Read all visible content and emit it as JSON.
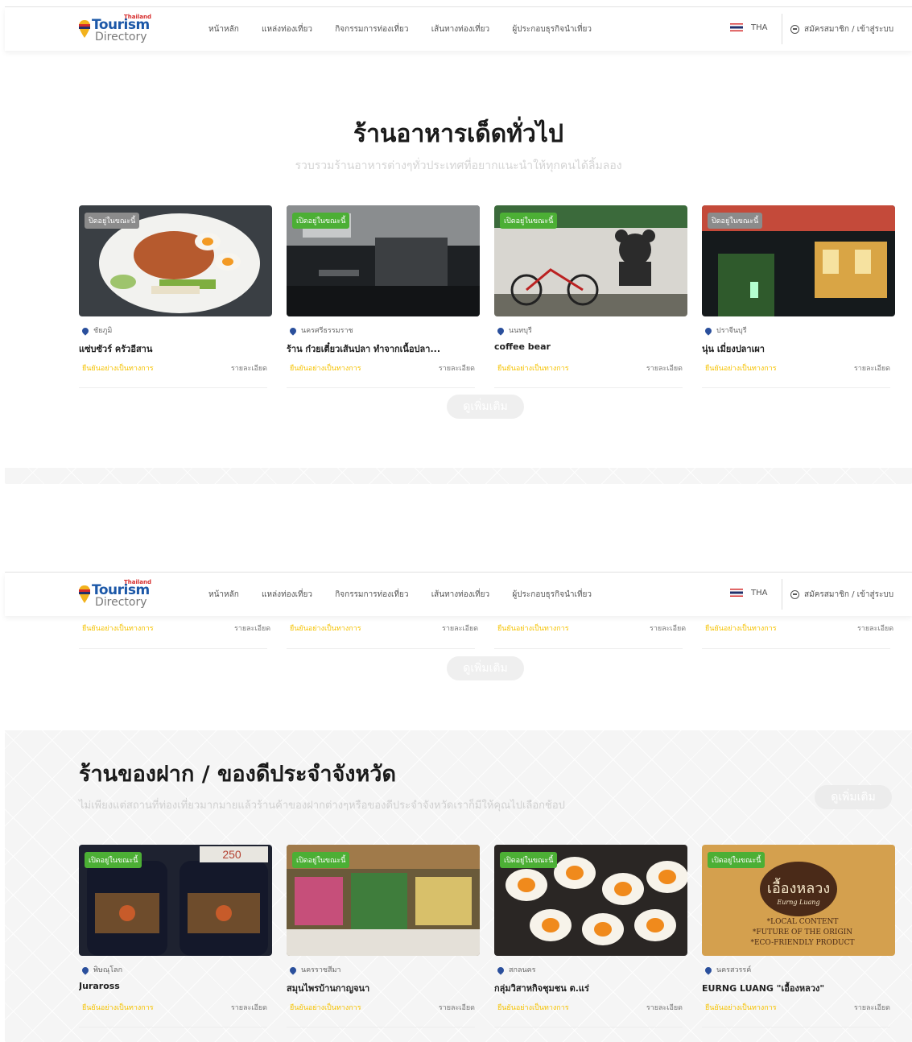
{
  "nav": {
    "logo_small": "Thailand",
    "logo_main": "Tourism",
    "logo_sub": "Directory",
    "menu": [
      "หน้าหลัก",
      "แหล่งท่องเที่ยว",
      "กิจกรรมการท่องเที่ยว",
      "เส้นทางท่องเที่ยว",
      "ผู้ประกอบธุรกิจนำเที่ยว"
    ],
    "lang": "THA",
    "login": "สมัครสมาชิก / เข้าสู่ระบบ"
  },
  "restaurants": {
    "title": "ร้านอาหารเด็ดทั่วไป",
    "subtitle": "รวบรวมร้านอาหารต่างๆทั่วประเทศที่อยากแนะนำให้ทุกคนได้ลิ้มลอง",
    "more": "ดูเพิ่มเติม",
    "cards": [
      {
        "badge": "ปิดอยู่ในขณะนี้",
        "status": "closed",
        "province": "ชัยภูมิ",
        "name": "แซ่บซัวร์ ครัวอีสาน",
        "verified": "ยืนยันอย่างเป็นทางการ",
        "detail": "รายละเอียด"
      },
      {
        "badge": "เปิดอยู่ในขณะนี้",
        "status": "open",
        "province": "นครศรีธรรมราช",
        "name": "ร้าน ก๋วยเตี๋ยวเส้นปลา ทำจากเนื้อปลา...",
        "verified": "ยืนยันอย่างเป็นทางการ",
        "detail": "รายละเอียด"
      },
      {
        "badge": "เปิดอยู่ในขณะนี้",
        "status": "open",
        "province": "นนทบุรี",
        "name": "coffee bear",
        "verified": "ยืนยันอย่างเป็นทางการ",
        "detail": "รายละเอียด"
      },
      {
        "badge": "ปิดอยู่ในขณะนี้",
        "status": "closed",
        "province": "ปราจีนบุรี",
        "name": "นุ่น เมี่ยงปลาเผา",
        "verified": "ยืนยันอย่างเป็นทางการ",
        "detail": "รายละเอียด"
      }
    ]
  },
  "scrolled": {
    "verified": "ยืนยันอย่างเป็นทางการ",
    "detail": "รายละเอียด",
    "more": "ดูเพิ่มเติม"
  },
  "souvenirs": {
    "title": "ร้านของฝาก / ของดีประจำจังหวัด",
    "subtitle": "ไม่เพียงแต่สถานที่ท่องเที่ยวมากมายแล้วร้านค้าของฝากต่างๆหรือของดีประจำจังหวัดเราก็มีให้คุณไปเลือกช้อป",
    "more": "ดูเพิ่มเติม",
    "cards": [
      {
        "badge": "เปิดอยู่ในขณะนี้",
        "status": "open",
        "province": "พิษณุโลก",
        "name": "Juraross",
        "verified": "ยืนยันอย่างเป็นทางการ",
        "detail": "รายละเอียด"
      },
      {
        "badge": "เปิดอยู่ในขณะนี้",
        "status": "open",
        "province": "นครราชสีมา",
        "name": "สมุนไพรบ้านกาญจนา",
        "verified": "ยืนยันอย่างเป็นทางการ",
        "detail": "รายละเอียด"
      },
      {
        "badge": "เปิดอยู่ในขณะนี้",
        "status": "open",
        "province": "สกลนคร",
        "name": "กลุ่มวิสาหกิจชุมชน ต.แร่",
        "verified": "ยืนยันอย่างเป็นทางการ",
        "detail": "รายละเอียด"
      },
      {
        "badge": "เปิดอยู่ในขณะนี้",
        "status": "open",
        "province": "นครสวรรค์",
        "name": "EURNG LUANG \"เอื้องหลวง\"",
        "verified": "ยืนยันอย่างเป็นทางการ",
        "detail": "รายละเอียด"
      }
    ],
    "img4_text": [
      "เอื้องหลวง",
      "Eurng Luang",
      "*LOCAL CONTENT",
      "*FUTURE OF THE ORIGIN",
      "*ECO-FRIENDLY PRODUCT"
    ],
    "img1_text": "250"
  },
  "colors": {
    "open_badge": "#4caf35",
    "closed_badge": "#8b8b8b",
    "verified": "#f5c200",
    "brand": "#1c58a8"
  }
}
